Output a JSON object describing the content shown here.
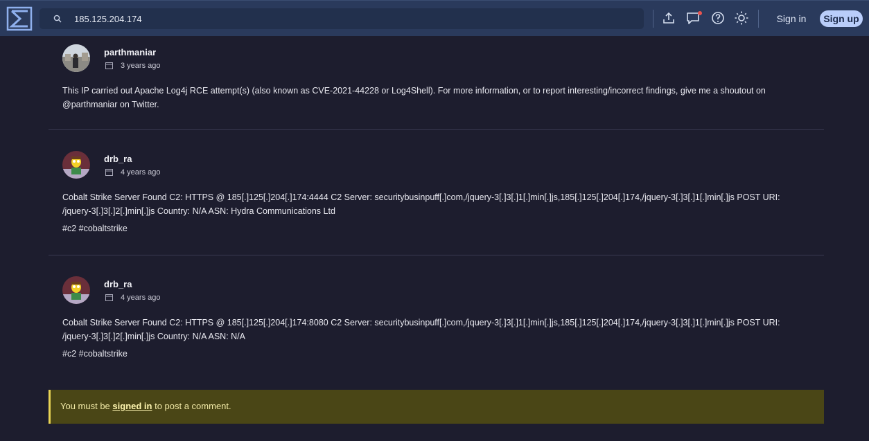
{
  "header": {
    "search_value": "185.125.204.174",
    "icons": [
      "logo-icon",
      "search-icon",
      "upload-icon",
      "chat-icon",
      "help-icon",
      "theme-icon"
    ],
    "signin_label": "Sign in",
    "signup_label": "Sign up",
    "colors": {
      "bar": "#2a3a5c",
      "accent": "#b9cdfa",
      "notification": "#e8544f"
    }
  },
  "comments": [
    {
      "author": "parthmaniar",
      "time": "3 years ago",
      "body": "This IP carried out Apache Log4j RCE attempt(s) (also known as CVE-2021-44228 or Log4Shell). For more information, or to report interesting/incorrect findings, give me a shoutout on @parthmaniar on Twitter.",
      "tags": ""
    },
    {
      "author": "drb_ra",
      "time": "4 years ago",
      "body": "Cobalt Strike Server Found C2: HTTPS @ 185[.]125[.]204[.]174:4444 C2 Server: securitybusinpuff[.]com,/jquery-3[.]3[.]1[.]min[.]js,185[.]125[.]204[.]174,/jquery-3[.]3[.]1[.]min[.]js POST URI: /jquery-3[.]3[.]2[.]min[.]js Country: N/A ASN: Hydra Communications Ltd",
      "tags": "#c2 #cobaltstrike"
    },
    {
      "author": "drb_ra",
      "time": "4 years ago",
      "body": "Cobalt Strike Server Found C2: HTTPS @ 185[.]125[.]204[.]174:8080 C2 Server: securitybusinpuff[.]com,/jquery-3[.]3[.]1[.]min[.]js,185[.]125[.]204[.]174,/jquery-3[.]3[.]1[.]min[.]js POST URI: /jquery-3[.]3[.]2[.]min[.]js Country: N/A ASN: N/A",
      "tags": "#c2 #cobaltstrike"
    }
  ],
  "notice": {
    "prefix": "You must be ",
    "link": "signed in",
    "suffix": " to post a comment."
  }
}
